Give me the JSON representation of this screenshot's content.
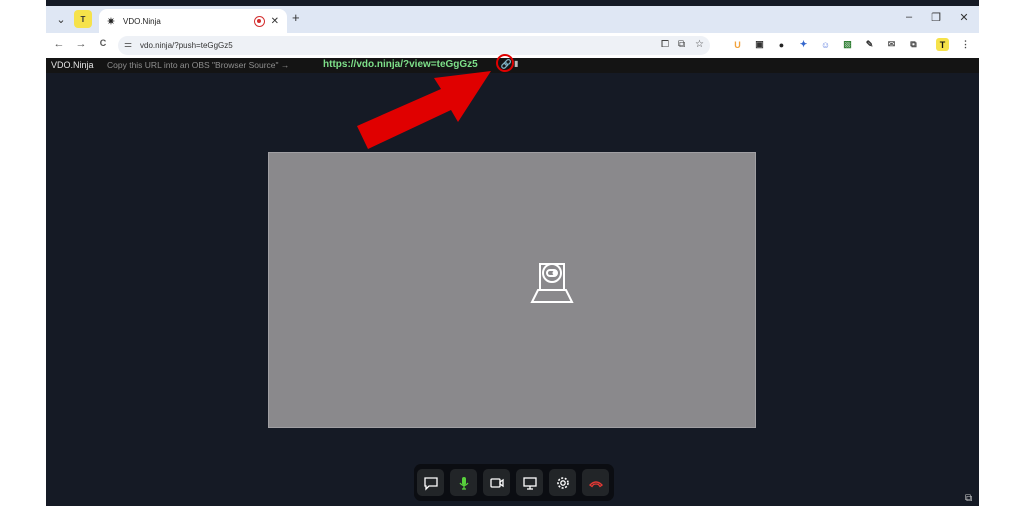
{
  "browser": {
    "tab": {
      "title": "VDO.Ninja"
    },
    "new_tab": "+",
    "address": {
      "url": "vdo.ninja/?push=teGgGz5"
    },
    "window_controls": {
      "minimize": "–",
      "restore": "❐",
      "close": "✕"
    },
    "nav": {
      "back": "←",
      "forward": "→",
      "reload": "C"
    },
    "extensions": [
      {
        "label": "U",
        "color": "#f2a23b"
      },
      {
        "label": "▣",
        "color": "#333333"
      },
      {
        "label": "●",
        "color": "#222222"
      },
      {
        "label": "✦",
        "color": "#3366cc"
      },
      {
        "label": "☺",
        "color": "#5577dd"
      },
      {
        "label": "▧",
        "color": "#2e7d32"
      },
      {
        "label": "✎",
        "color": "#333333"
      },
      {
        "label": "✉",
        "color": "#555555"
      },
      {
        "label": "⧉",
        "color": "#444444"
      },
      {
        "label": "T",
        "color": "#111111"
      },
      {
        "label": "⋮",
        "color": "#444444"
      }
    ]
  },
  "page": {
    "brand": "VDO.Ninja",
    "instruction": "Copy this URL into an OBS \"Browser Source\" →",
    "share_url": "https://vdo.ninja/?view=teGgGz5",
    "accent_color": "#7ee08a",
    "annotation_color": "#e00000"
  },
  "controls": [
    {
      "name": "chat",
      "icon": "chat-icon"
    },
    {
      "name": "microphone",
      "icon": "microphone-icon",
      "active": true
    },
    {
      "name": "camera",
      "icon": "camera-icon"
    },
    {
      "name": "screen-share",
      "icon": "screen-share-icon"
    },
    {
      "name": "settings",
      "icon": "gear-icon"
    },
    {
      "name": "hang-up",
      "icon": "hangup-icon"
    }
  ]
}
